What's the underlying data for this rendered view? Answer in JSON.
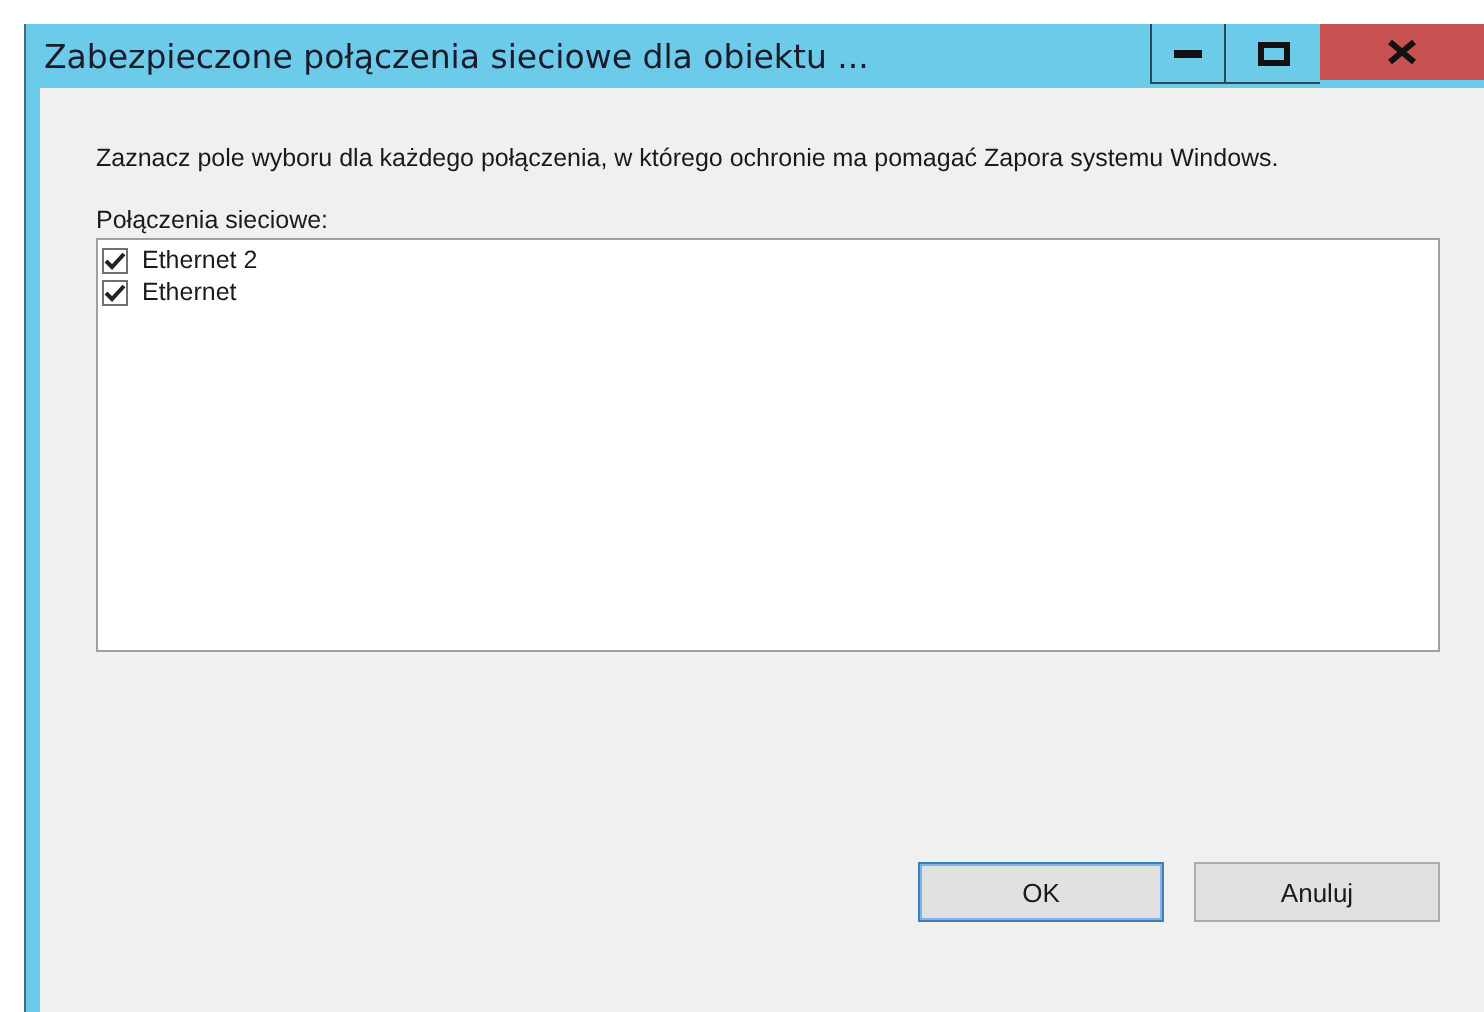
{
  "window": {
    "title": "Zabezpieczone połączenia sieciowe dla obiektu ..."
  },
  "description": "Zaznacz pole wyboru dla każdego połączenia, w którego ochronie ma pomagać Zapora systemu Windows.",
  "list": {
    "label": "Połączenia sieciowe:",
    "items": [
      {
        "label": "Ethernet 2",
        "checked": true
      },
      {
        "label": "Ethernet",
        "checked": true
      }
    ]
  },
  "buttons": [
    {
      "label": "OK",
      "kind": "default"
    },
    {
      "label": "Anuluj",
      "kind": "normal"
    }
  ]
}
